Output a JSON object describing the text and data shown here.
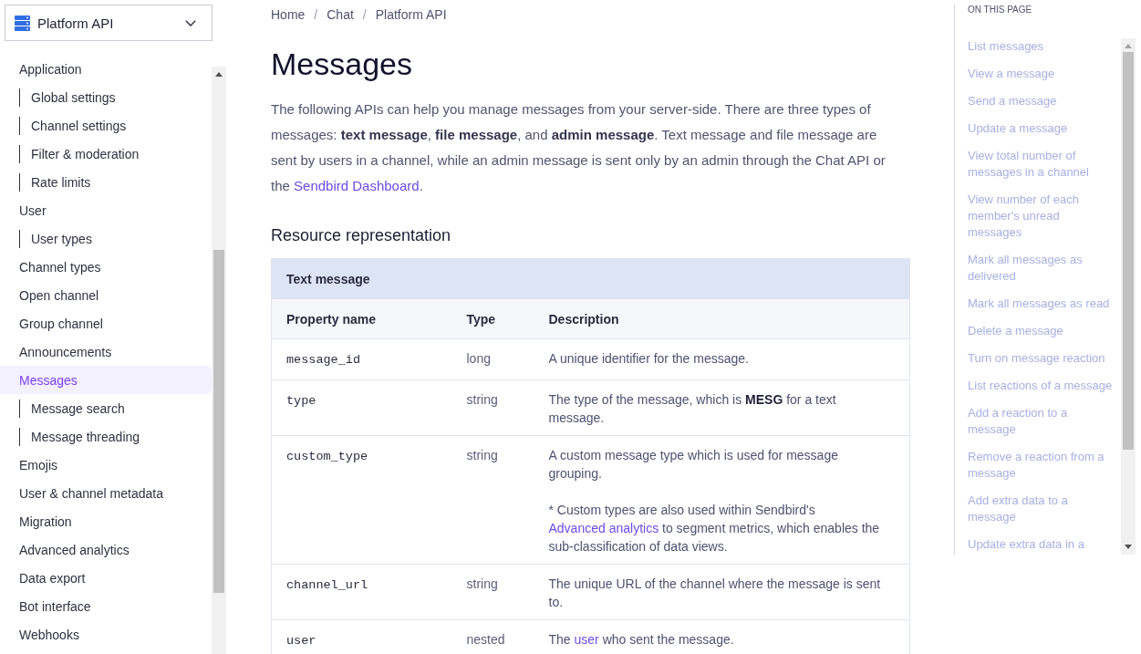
{
  "sidebar": {
    "selector": {
      "label": "Platform API"
    },
    "items": [
      {
        "label": "Application",
        "selected": false,
        "children": [
          {
            "label": "Global settings",
            "selected": false
          },
          {
            "label": "Channel settings",
            "selected": false
          },
          {
            "label": "Filter & moderation",
            "selected": false
          },
          {
            "label": "Rate limits",
            "selected": false
          }
        ]
      },
      {
        "label": "User",
        "selected": false,
        "children": [
          {
            "label": "User types",
            "selected": false
          }
        ]
      },
      {
        "label": "Channel types",
        "selected": false
      },
      {
        "label": "Open channel",
        "selected": false
      },
      {
        "label": "Group channel",
        "selected": false
      },
      {
        "label": "Announcements",
        "selected": false
      },
      {
        "label": "Messages",
        "selected": true,
        "children": [
          {
            "label": "Message search",
            "selected": false
          },
          {
            "label": "Message threading",
            "selected": false
          }
        ]
      },
      {
        "label": "Emojis",
        "selected": false
      },
      {
        "label": "User & channel metadata",
        "selected": false
      },
      {
        "label": "Migration",
        "selected": false
      },
      {
        "label": "Advanced analytics",
        "selected": false
      },
      {
        "label": "Data export",
        "selected": false
      },
      {
        "label": "Bot interface",
        "selected": false
      },
      {
        "label": "Webhooks",
        "selected": false
      }
    ]
  },
  "breadcrumb": [
    {
      "kind": "link",
      "text": "Home"
    },
    {
      "kind": "separator",
      "text": "/"
    },
    {
      "kind": "link",
      "text": "Chat"
    },
    {
      "kind": "separator",
      "text": "/"
    },
    {
      "kind": "link",
      "text": "Platform API"
    }
  ],
  "title": "Messages",
  "intro": [
    {
      "kind": "text",
      "text": "The following APIs can help you manage messages from your server-side. There are three types of messages: **text message**, **file message**, and **admin message**. Text message and file message are sent by users in a channel, while an admin message is sent only by an admin through the Chat API or the "
    },
    {
      "kind": "link",
      "text": "Sendbird Dashboard"
    },
    {
      "kind": "text",
      "text": "."
    }
  ],
  "section_heading": "Resource representation",
  "table": {
    "caption": "Text message",
    "columns": [
      "Property name",
      "Type",
      "Description"
    ],
    "rows": [
      {
        "property": "message_id",
        "type": "long",
        "description": [
          [
            {
              "kind": "text",
              "text": "A unique identifier for the message."
            }
          ]
        ]
      },
      {
        "property": "type",
        "type": "string",
        "description": [
          [
            {
              "kind": "text",
              "text": "The type of the message, which is **MESG** for a text message."
            }
          ]
        ]
      },
      {
        "property": "custom_type",
        "type": "string",
        "description": [
          [
            {
              "kind": "text",
              "text": "A custom message type which is used for message grouping."
            }
          ],
          [
            {
              "kind": "text",
              "text": "* Custom types are also used within Sendbird's "
            },
            {
              "kind": "link",
              "text": "Advanced analytics"
            },
            {
              "kind": "text",
              "text": " to segment metrics, which enables the sub-classification of data views."
            }
          ]
        ]
      },
      {
        "property": "channel_url",
        "type": "string",
        "description": [
          [
            {
              "kind": "text",
              "text": "The unique URL of the channel where the message is sent to."
            }
          ]
        ]
      },
      {
        "property": "user",
        "type": "nested",
        "description": [
          [
            {
              "kind": "text",
              "text": "The "
            },
            {
              "kind": "link",
              "text": "user"
            },
            {
              "kind": "text",
              "text": " who sent the message."
            }
          ]
        ]
      }
    ]
  },
  "toc": {
    "heading": "ON THIS PAGE",
    "items": [
      "List messages",
      "View a message",
      "Send a message",
      "Update a message",
      "View total number of messages in a channel",
      "View number of each member's unread messages",
      "Mark all messages as delivered",
      "Mark all messages as read",
      "Delete a message",
      "Turn on message reaction",
      "List reactions of a message",
      "Add a reaction to a message",
      "Remove a reaction from a message",
      "Add extra data to a message",
      "Update extra data in a"
    ]
  }
}
